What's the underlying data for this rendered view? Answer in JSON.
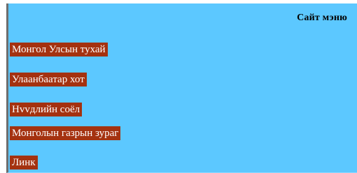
{
  "menu": {
    "header": "Сайт мэню",
    "items": [
      {
        "label": "Монгол Улсын тухай"
      },
      {
        "label": "Улаанбаатар хот"
      },
      {
        "label": "Нvvдлийн соёл"
      },
      {
        "label": "Монголын газрын зураг"
      },
      {
        "label": "Линк"
      }
    ]
  },
  "colors": {
    "panel_background": "#5cc8ff",
    "item_background": "#a43210",
    "item_text": "#ffffff",
    "header_text": "#000000",
    "left_border": "#6d6d6d"
  }
}
